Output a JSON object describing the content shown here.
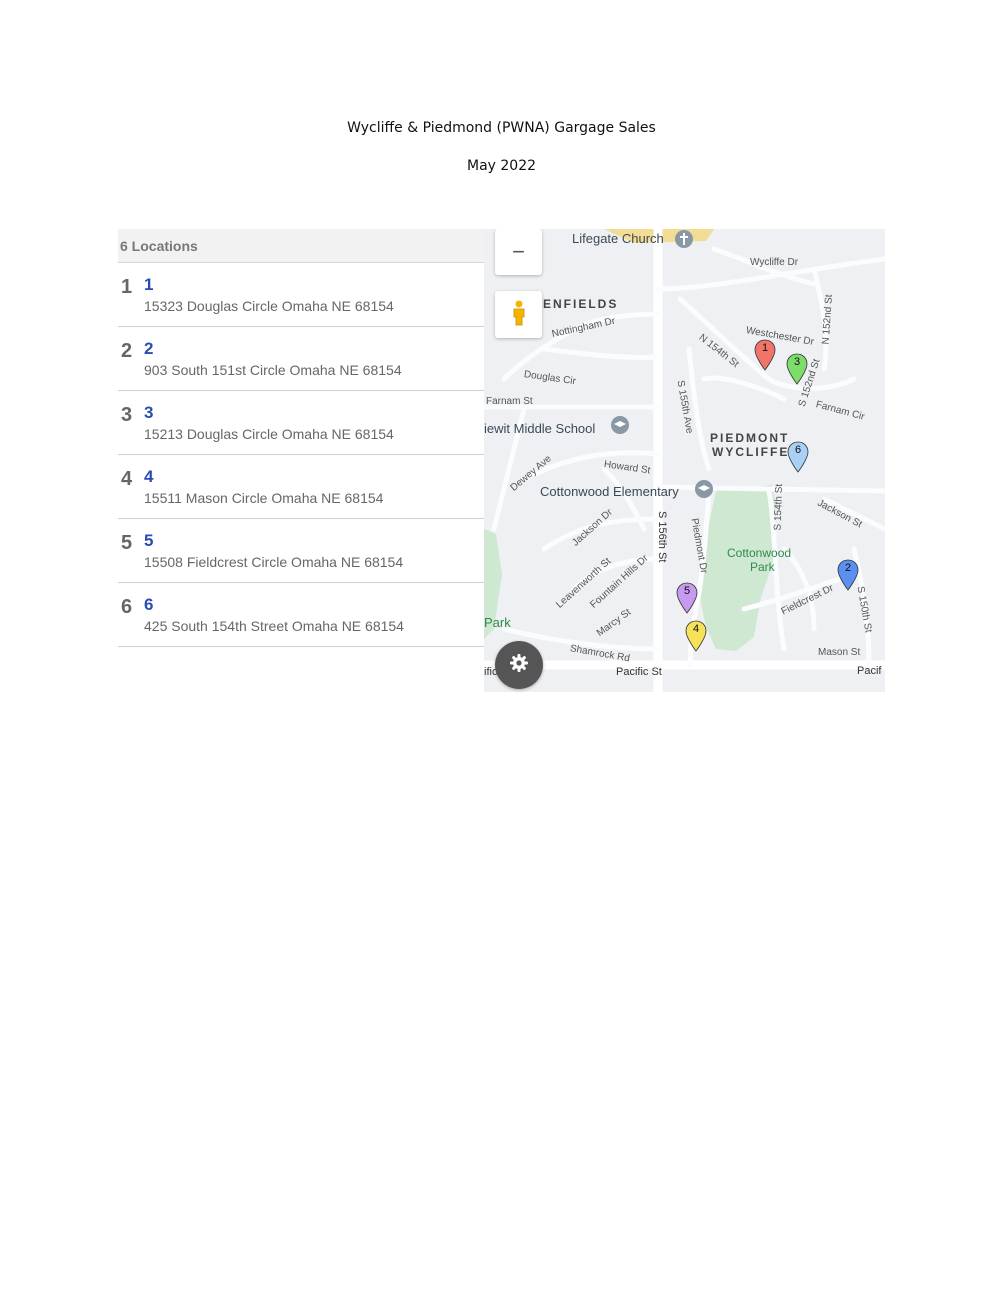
{
  "document": {
    "title": "Wycliffe & Piedmond (PWNA) Gargage Sales",
    "subtitle": "May 2022"
  },
  "panel": {
    "header": "6 Locations",
    "locations": [
      {
        "index": "1",
        "name": "1",
        "address": "15323 Douglas Circle Omaha NE 68154"
      },
      {
        "index": "2",
        "name": "2",
        "address": "903 South 151st Circle Omaha NE 68154"
      },
      {
        "index": "3",
        "name": "3",
        "address": "15213 Douglas Circle Omaha NE 68154"
      },
      {
        "index": "4",
        "name": "4",
        "address": "15511 Mason Circle Omaha NE 68154"
      },
      {
        "index": "5",
        "name": "5",
        "address": "15508 Fieldcrest Circle Omaha NE 68154"
      },
      {
        "index": "6",
        "name": "6",
        "address": "425 South 154th Street Omaha NE 68154"
      }
    ]
  },
  "map": {
    "zoom_out_label": "−",
    "pegman_icon": "pegman-icon",
    "settings_icon": "gear-icon",
    "labels": {
      "lifegate_church": "Lifegate Church",
      "wycliffe_dr": "Wycliffe Dr",
      "enfields": "ENFIELDS",
      "nottingham_dr": "Nottingham Dr",
      "n_154th_st": "N 154th St",
      "westchester_dr": "Westchester Dr",
      "n_152nd_st": "N 152nd St",
      "douglas_cir": "Douglas Cir",
      "s_155th_ave": "S 155th Ave",
      "s_152nd_st": "S 152nd St",
      "farnam_cir": "Farnam Cir",
      "farnam_st": "Farnam St",
      "kiewit_middle_school": "iewit Middle School",
      "piedmont": "PIEDMONT",
      "wycliffe": "WYCLIFFE",
      "dewey_ave": "Dewey Ave",
      "howard_st": "Howard St",
      "cottonwood_elementary": "Cottonwood Elementary",
      "jackson_st_e": "Jackson St",
      "s_156th_st": "S 156th St",
      "piedmont_dr": "Piedmont Dr",
      "s_154th_st": "S 154th St",
      "jackson_dr": "Jackson Dr",
      "cottonwood_park_1": "Cottonwood",
      "cottonwood_park_2": "Park",
      "leavenworth_st": "Leavenworth St",
      "fountain_hills_dr": "Fountain Hills Dr",
      "fieldcrest_dr": "Fieldcrest Dr",
      "s_150th_st": "S 150th St",
      "park": "Park",
      "marcy_st": "Marcy St",
      "shamrock_rd": "Shamrock Rd",
      "mason_st": "Mason St",
      "pacific_st": "Pacific St",
      "pacif": "Pacif",
      "ific": "ific"
    },
    "markers": [
      {
        "label": "1",
        "color": "#f07468"
      },
      {
        "label": "2",
        "color": "#5b8ff0"
      },
      {
        "label": "3",
        "color": "#7edc6a"
      },
      {
        "label": "4",
        "color": "#f5e15a"
      },
      {
        "label": "5",
        "color": "#c79af0"
      },
      {
        "label": "6",
        "color": "#a9d1f5"
      }
    ]
  }
}
